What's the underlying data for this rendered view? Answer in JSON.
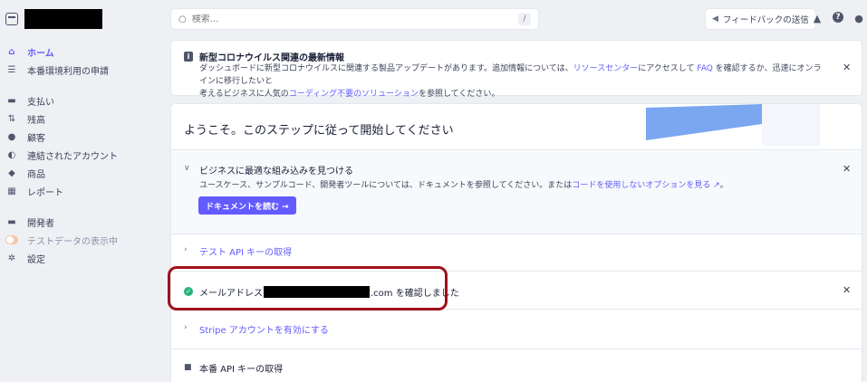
{
  "sidebar": {
    "account_name_redacted": true,
    "items": [
      {
        "label": "ホーム",
        "icon": "home-icon",
        "active": true
      },
      {
        "label": "本番環境利用の申請",
        "icon": "list-icon"
      },
      {
        "label": "支払い",
        "icon": "wallet-icon"
      },
      {
        "label": "残高",
        "icon": "balance-icon"
      },
      {
        "label": "顧客",
        "icon": "customer-icon"
      },
      {
        "label": "連結されたアカウント",
        "icon": "connected-icon"
      },
      {
        "label": "商品",
        "icon": "box-icon"
      },
      {
        "label": "レポート",
        "icon": "report-icon"
      },
      {
        "label": "開発者",
        "icon": "terminal-icon"
      },
      {
        "label": "テストデータの表示中",
        "icon": "toggle-icon"
      },
      {
        "label": "設定",
        "icon": "gear-icon"
      }
    ]
  },
  "topbar": {
    "search_placeholder": "検索...",
    "search_shortcut": "/",
    "feedback_label": "フィードバックの送信"
  },
  "notice": {
    "title": "新型コロナウイルス関連の最新情報",
    "line1_a": "ダッシュボードに新型コロナウイルスに関連する製品アップデートがあります。追加情報については、",
    "line1_link1": "リソースセンター",
    "line1_b": "にアクセスして ",
    "line1_link2": "FAQ",
    "line1_c": " を確認するか、迅速にオンラインに移行したいと",
    "line2_a": "考えるビジネスに人気の",
    "line2_link": "コーディング不要のソリューション",
    "line2_b": "を参照してください。"
  },
  "steps": {
    "welcome": "ようこそ。このステップに従って開始してください",
    "step1": {
      "title": "ビジネスに最適な組み込みを見つける",
      "desc_a": "ユースケース、サンプルコード、開発者ツールについては、ドキュメントを参照してください。または",
      "desc_link": "コードを使用しないオプションを見る",
      "button": "ドキュメントを読む →"
    },
    "step2": {
      "title": "テスト API キーの取得"
    },
    "step3": {
      "prefix": "メールアドレス",
      "suffix": ".com を確認しました"
    },
    "step4": {
      "title": "Stripe アカウントを有効にする"
    },
    "step5": {
      "title": "本番 API キーの取得"
    }
  },
  "colors": {
    "accent": "#635bff",
    "success": "#24b47e",
    "highlight": "#a0101a"
  }
}
